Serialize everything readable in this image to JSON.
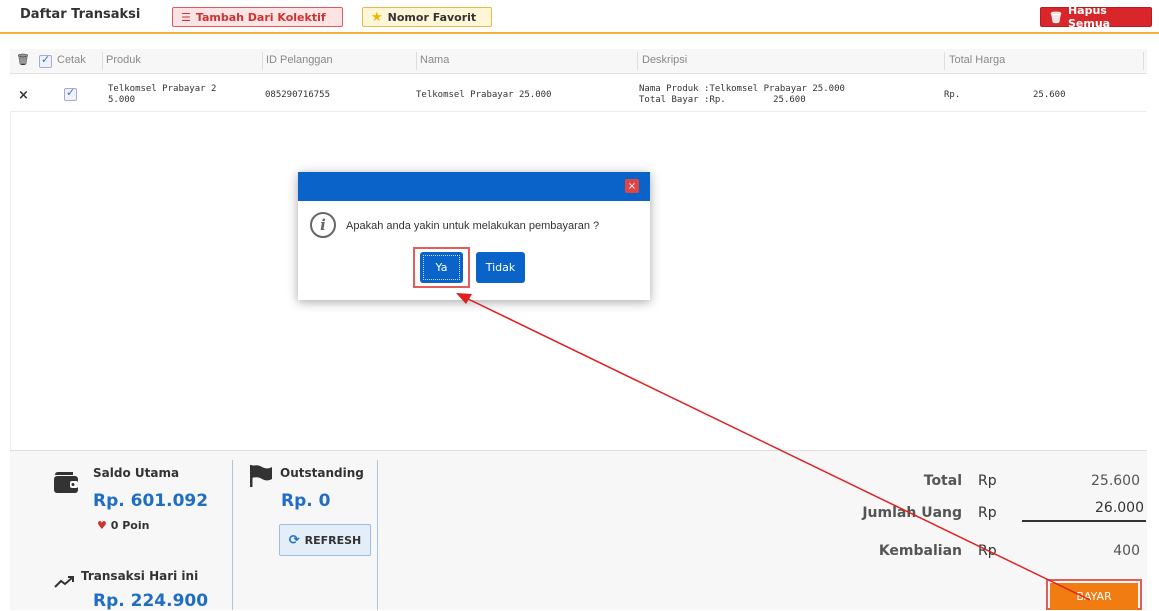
{
  "header": {
    "title": "Daftar Transaksi",
    "btn_kolektif": "Tambah Dari Kolektif",
    "btn_favorit": "Nomor Favorit",
    "btn_hapus": "Hapus Semua"
  },
  "table": {
    "col_cetak": "Cetak",
    "col_produk": "Produk",
    "col_id": "ID Pelanggan",
    "col_nama": "Nama",
    "col_deskripsi": "Deskripsi",
    "col_total": "Total Harga",
    "rows": [
      {
        "produk_l1": "Telkomsel Prabayar 2",
        "produk_l2": "5.000",
        "id_pelanggan": "085290716755",
        "nama": "Telkomsel Prabayar 25.000",
        "desk_l1": "Nama Produk :Telkomsel Prabayar 25.000",
        "desk_l2a": "Total Bayar :Rp.",
        "desk_l2b": "25.600",
        "total_rp": "Rp.",
        "total_val": "25.600"
      }
    ]
  },
  "dialog": {
    "message": "Apakah anda yakin untuk melakukan pembayaran ?",
    "btn_yes": "Ya",
    "btn_no": "Tidak",
    "close": "×"
  },
  "summary": {
    "saldo_label": "Saldo Utama",
    "saldo_value": "Rp. 601.092",
    "poin": "0 Poin",
    "transaksi_label": "Transaksi Hari ini",
    "transaksi_value": "Rp. 224.900",
    "outstanding_label": "Outstanding",
    "outstanding_value": "Rp. 0",
    "refresh": "REFRESH",
    "total_label": "Total",
    "total_rp": "Rp",
    "total_value": "25.600",
    "jumlah_label": "Jumlah Uang",
    "jumlah_rp": "Rp",
    "jumlah_value": "26.000",
    "kembalian_label": "Kembalian",
    "kembalian_rp": "Rp",
    "kembalian_value": "400",
    "bayar": "BAYAR"
  },
  "colors": {
    "accent_blue": "#0a63c9",
    "value_blue": "#1f6ec4",
    "bayar_orange": "#f07c12",
    "danger_red": "#d9262a",
    "highlight_red": "#e25c5c"
  }
}
